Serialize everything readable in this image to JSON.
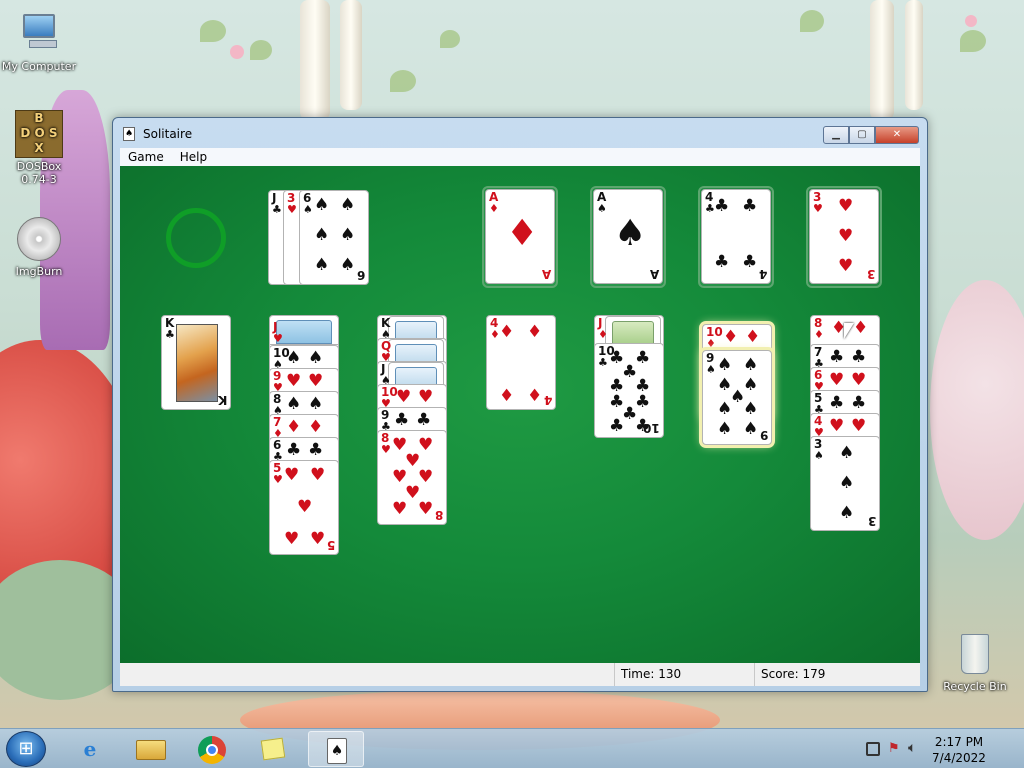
{
  "desktop": {
    "icons": [
      {
        "label": "My Computer"
      },
      {
        "label": "DOSBox 0.74-3"
      },
      {
        "label": "ImgBurn"
      },
      {
        "label": "Recycle Bin"
      }
    ]
  },
  "window": {
    "title": "Solitaire",
    "menu": [
      "Game",
      "Help"
    ],
    "status": {
      "time_label": "Time:",
      "time_value": "130",
      "score_label": "Score:",
      "score_value": "179"
    }
  },
  "game": {
    "waste": [
      "J♣",
      "3♥",
      "6♠"
    ],
    "foundations": [
      {
        "rank": "A",
        "suit": "♦",
        "color": "red"
      },
      {
        "rank": "A",
        "suit": "♠",
        "color": "black"
      },
      {
        "rank": "4",
        "suit": "♣",
        "color": "black"
      },
      {
        "rank": "3",
        "suit": "♥",
        "color": "red"
      }
    ],
    "tableau": [
      {
        "facedown": 0,
        "faceup": [
          "K♣"
        ]
      },
      {
        "facedown": 1,
        "faceup": [
          "J♥",
          "10♠",
          "9♥",
          "8♠",
          "7♦",
          "6♣",
          "5♥"
        ]
      },
      {
        "facedown": 0,
        "faceup": [
          "K♠",
          "Q♥",
          "J♠",
          "10♥",
          "9♣",
          "8♥"
        ]
      },
      {
        "facedown": 0,
        "faceup": [
          "4♦"
        ]
      },
      {
        "facedown": 0,
        "faceup": [
          "J♦",
          "10♣"
        ]
      },
      {
        "facedown": 0,
        "faceup": [
          "10♦",
          "9♠"
        ]
      },
      {
        "facedown": 0,
        "faceup": [
          "8♦",
          "7♣",
          "6♥",
          "5♣",
          "4♥",
          "3♠"
        ]
      }
    ]
  },
  "taskbar": {
    "time": "2:17 PM",
    "date": "7/4/2022"
  }
}
